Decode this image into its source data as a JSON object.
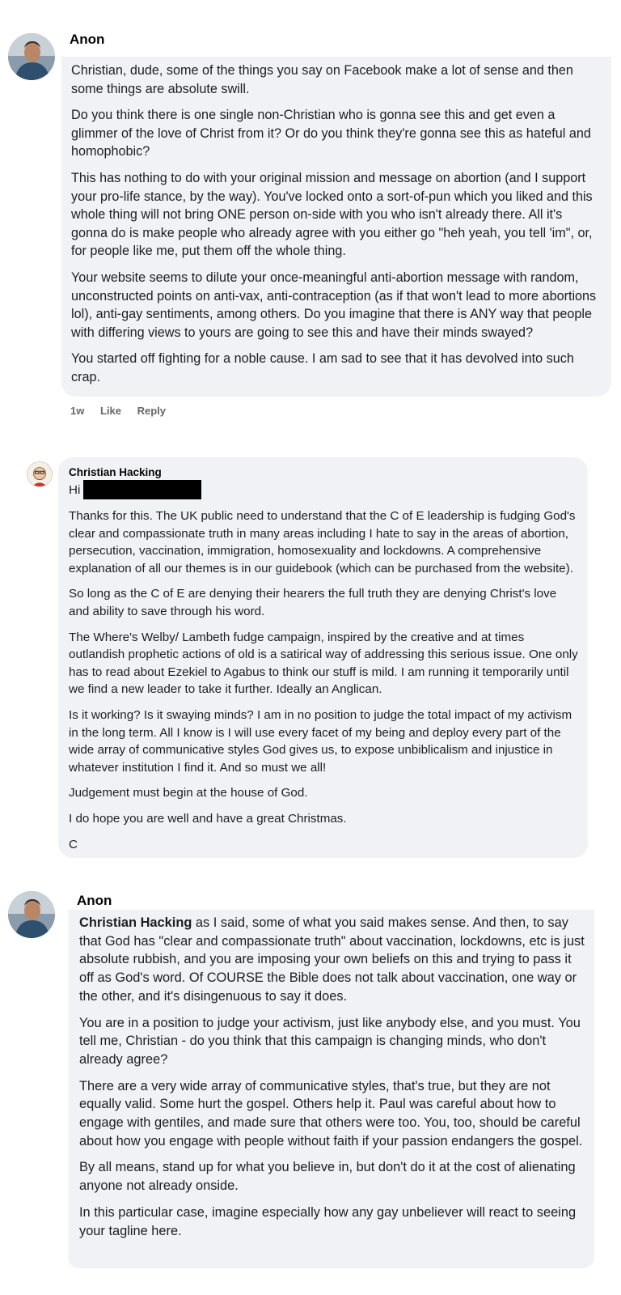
{
  "comment1": {
    "author": "Anon",
    "paragraphs": [
      "Christian, dude, some of the things you say on Facebook make a lot of sense and then some things are absolute swill.",
      "Do you think there is one single non-Christian who is gonna see this and get even a glimmer of the love of Christ from it? Or do you think they're gonna see this as hateful and homophobic?",
      "This has nothing to do with your original mission and message on abortion (and I support your pro-life stance, by the way). You've locked onto a sort-of-pun which you liked and this whole thing will not bring ONE person on-side with you who isn't already there. All it's gonna do is make people who already agree with you either go \"heh yeah, you tell 'im\", or, for people like me, put them off the whole thing.",
      "Your website seems to dilute your once-meaningful anti-abortion message with random, unconstructed points on anti-vax, anti-contraception (as if that won't lead to more abortions lol), anti-gay sentiments, among others. Do you imagine that there is ANY way that people with differing views to yours are going to see this and have their minds swayed?",
      "You started off fighting for a noble cause. I am sad to see that it has devolved into such crap."
    ],
    "time": "1w",
    "like": "Like",
    "reply": "Reply"
  },
  "comment2": {
    "author": "Christian Hacking",
    "greeting": "Hi",
    "paragraphs": [
      "Thanks for this. The UK public need to understand that the C of E leadership is fudging God's clear and compassionate truth in many areas including I hate to say in the areas of abortion, persecution, vaccination, immigration, homosexuality and lockdowns. A comprehensive explanation of all our themes is in our guidebook (which can be purchased from the website).",
      "So long as the C of E are denying their hearers the full truth they are denying Christ's love and ability to save through his word.",
      "The Where's Welby/ Lambeth fudge campaign, inspired by the creative and at times outlandish prophetic actions of old is a satirical way of addressing this serious issue. One only has to read about Ezekiel to Agabus to think our stuff is mild. I am running it temporarily until we find a new leader to take it further. Ideally an Anglican.",
      "Is it working? Is it swaying minds? I am in no position to judge the total impact of my activism in the long term. All I know is I will use every facet of my being and deploy every part of the wide array of communicative styles God gives us, to expose unbiblicalism and injustice in whatever institution I find it. And so must we all!",
      "Judgement must begin at the house of God.",
      "I do hope you are well and have a great Christmas.",
      "C"
    ]
  },
  "comment3": {
    "author": "Anon",
    "mention": "Christian Hacking",
    "first_paragraph_rest": " as I said, some of what you said makes sense. And then, to say that God has \"clear and compassionate truth\" about vaccination, lockdowns, etc is just absolute rubbish, and you are imposing your own beliefs on this and trying to pass it off as God's word. Of COURSE the Bible does not talk about vaccination, one way or the other, and it's disingenuous to say it does.",
    "paragraphs": [
      "You are in a position to judge your activism, just like anybody else, and you must. You tell me, Christian - do you think that this campaign is changing minds, who don't already agree?",
      "There are a very wide array of communicative styles, that's true, but they are not equally valid. Some hurt the gospel. Others help it. Paul was careful about how to engage with gentiles, and made sure that others were too. You, too, should be careful about how you engage with people without faith if your passion endangers the gospel.",
      "By all means, stand up for what you believe in, but don't do it at the cost of alienating anyone not already onside.",
      "In this particular case, imagine especially how any gay unbeliever will react to seeing your tagline here."
    ]
  }
}
